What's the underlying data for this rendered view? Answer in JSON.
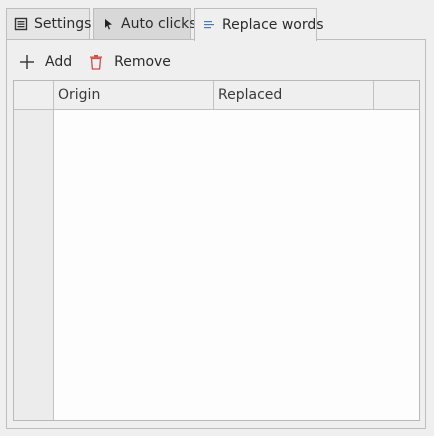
{
  "tabs": [
    {
      "label": "Settings",
      "icon": "settings-list-icon"
    },
    {
      "label": "Auto clicks",
      "icon": "cursor-icon"
    },
    {
      "label": "Replace words",
      "icon": "text-lines-icon",
      "active": true
    }
  ],
  "toolbar": {
    "add_label": "Add",
    "remove_label": "Remove",
    "remove_color": "#d24a4a"
  },
  "table": {
    "columns": [
      "",
      "Origin",
      "Replaced",
      ""
    ],
    "rows": []
  }
}
